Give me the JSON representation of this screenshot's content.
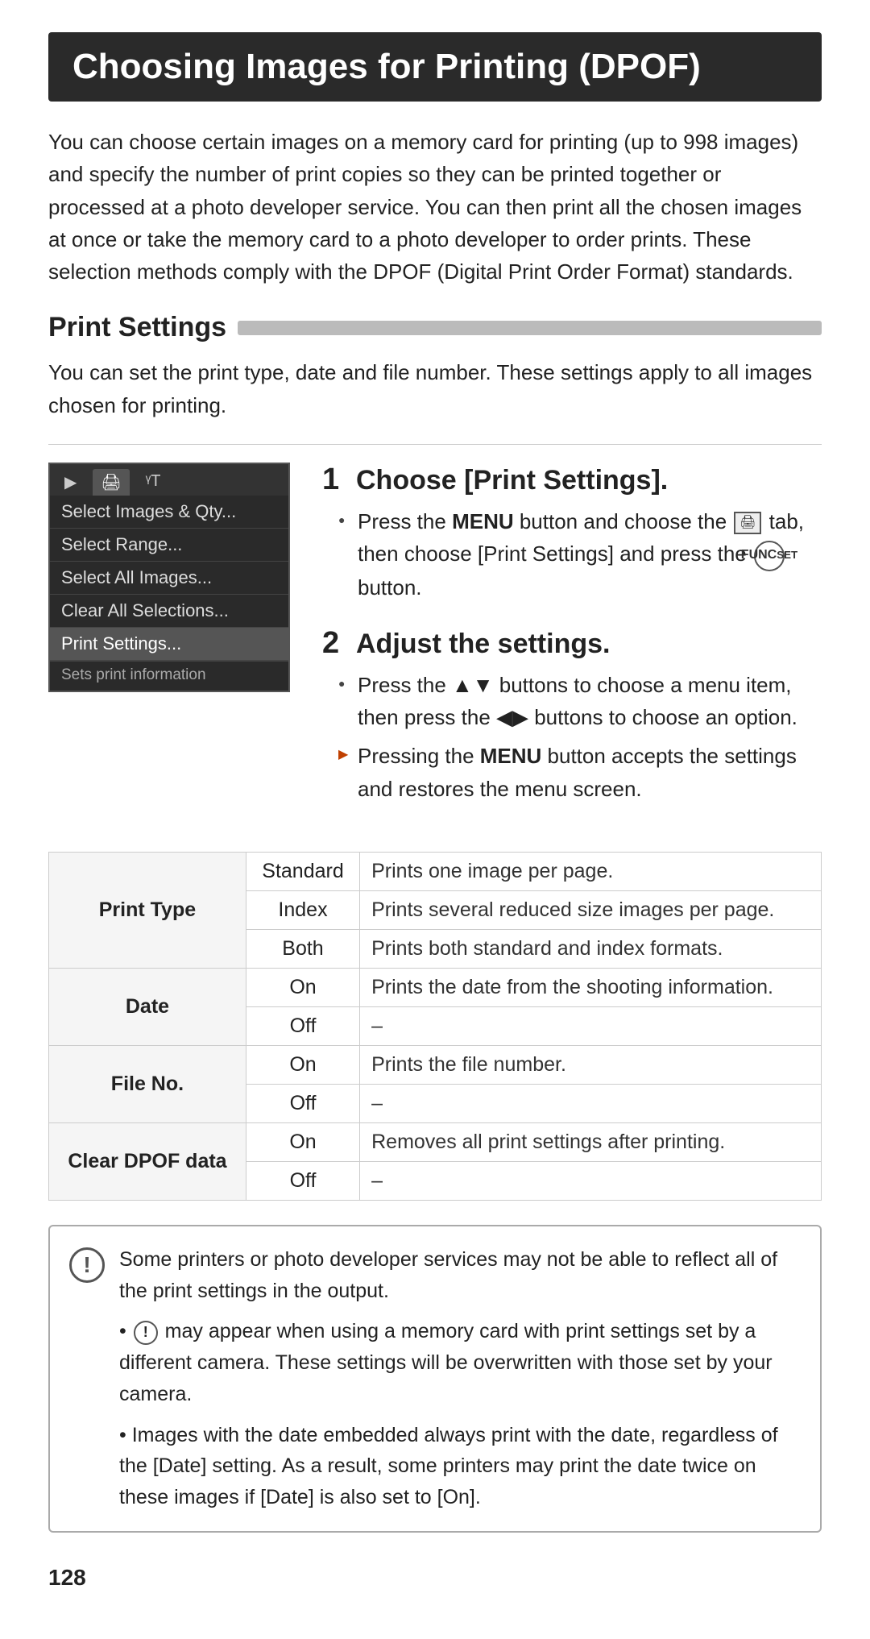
{
  "page": {
    "title": "Choosing Images for Printing (DPOF)",
    "intro": "You can choose certain images on a memory card for printing (up to 998 images) and specify the number of print copies so they can be printed together or processed at a photo developer service. You can then print all the chosen images at once or take the memory card to a photo developer to order prints. These selection methods comply with the DPOF (Digital Print Order Format) standards.",
    "section_heading": "Print Settings",
    "section_desc": "You can set the print type, date and file number. These settings apply to all images chosen for printing.",
    "page_number": "128"
  },
  "camera_menu": {
    "tabs": [
      {
        "label": "▶",
        "active": false
      },
      {
        "label": "🖨",
        "active": true
      },
      {
        "label": "ᵞT",
        "active": false
      }
    ],
    "items": [
      {
        "text": "Select Images & Qty...",
        "highlighted": false
      },
      {
        "text": "Select Range...",
        "highlighted": false
      },
      {
        "text": "Select All Images...",
        "highlighted": false
      },
      {
        "text": "Clear All Selections...",
        "highlighted": false
      },
      {
        "text": "Print Settings...",
        "highlighted": true
      },
      {
        "text": "Sets print information",
        "footer": true
      }
    ]
  },
  "steps": [
    {
      "number": "1",
      "title": "Choose [Print Settings].",
      "bullets": [
        {
          "type": "circle",
          "text": "Press the MENU button and choose the tab, then choose [Print Settings] and press the button."
        }
      ]
    },
    {
      "number": "2",
      "title": "Adjust the settings.",
      "bullets": [
        {
          "type": "circle",
          "text": "Press the ▲▼ buttons to choose a menu item, then press the ◀▶ buttons to choose an option."
        },
        {
          "type": "triangle",
          "text": "Pressing the MENU button accepts the settings and restores the menu screen."
        }
      ]
    }
  ],
  "settings_table": {
    "rows": [
      {
        "header": "Print Type",
        "options": [
          {
            "option": "Standard",
            "desc": "Prints one image per page."
          },
          {
            "option": "Index",
            "desc": "Prints several reduced size images per page."
          },
          {
            "option": "Both",
            "desc": "Prints both standard and index formats."
          }
        ]
      },
      {
        "header": "Date",
        "options": [
          {
            "option": "On",
            "desc": "Prints the date from the shooting information."
          },
          {
            "option": "Off",
            "desc": "–"
          }
        ]
      },
      {
        "header": "File No.",
        "options": [
          {
            "option": "On",
            "desc": "Prints the file number."
          },
          {
            "option": "Off",
            "desc": "–"
          }
        ]
      },
      {
        "header": "Clear DPOF data",
        "options": [
          {
            "option": "On",
            "desc": "Removes all print settings after printing."
          },
          {
            "option": "Off",
            "desc": "–"
          }
        ]
      }
    ]
  },
  "notes": [
    "Some printers or photo developer services may not be able to reflect all of the print settings in the output.",
    "may appear when using a memory card with print settings set by a different camera. These settings will be overwritten with those set by your camera.",
    "Images with the date embedded always print with the date, regardless of the [Date] setting. As a result, some printers may print the date twice on these images if [Date] is also set to [On]."
  ]
}
